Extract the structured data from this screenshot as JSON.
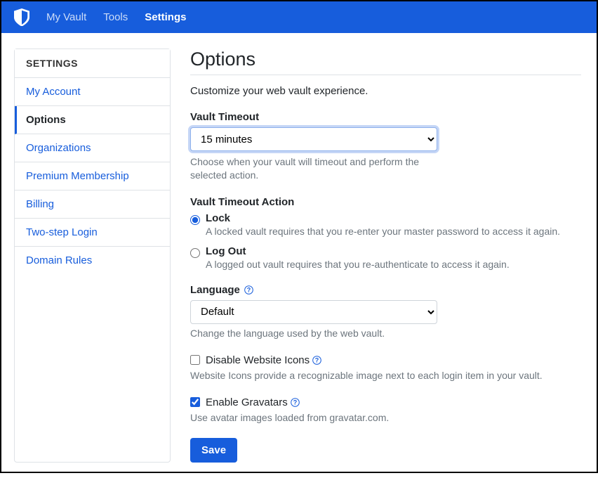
{
  "nav": {
    "items": [
      {
        "label": "My Vault",
        "active": false
      },
      {
        "label": "Tools",
        "active": false
      },
      {
        "label": "Settings",
        "active": true
      }
    ]
  },
  "sidebar": {
    "header": "SETTINGS",
    "items": [
      {
        "label": "My Account",
        "active": false
      },
      {
        "label": "Options",
        "active": true
      },
      {
        "label": "Organizations",
        "active": false
      },
      {
        "label": "Premium Membership",
        "active": false
      },
      {
        "label": "Billing",
        "active": false
      },
      {
        "label": "Two-step Login",
        "active": false
      },
      {
        "label": "Domain Rules",
        "active": false
      }
    ]
  },
  "page": {
    "title": "Options",
    "description": "Customize your web vault experience."
  },
  "vaultTimeout": {
    "label": "Vault Timeout",
    "value": "15 minutes",
    "help": "Choose when your vault will timeout and perform the selected action."
  },
  "vaultTimeoutAction": {
    "label": "Vault Timeout Action",
    "options": [
      {
        "label": "Lock",
        "desc": "A locked vault requires that you re-enter your master password to access it again.",
        "checked": true
      },
      {
        "label": "Log Out",
        "desc": "A logged out vault requires that you re-authenticate to access it again.",
        "checked": false
      }
    ]
  },
  "language": {
    "label": "Language",
    "value": "Default",
    "help": "Change the language used by the web vault."
  },
  "disableIcons": {
    "label": "Disable Website Icons",
    "checked": false,
    "help": "Website Icons provide a recognizable image next to each login item in your vault."
  },
  "enableGravatars": {
    "label": "Enable Gravatars",
    "checked": true,
    "help": "Use avatar images loaded from gravatar.com."
  },
  "save": {
    "label": "Save"
  }
}
